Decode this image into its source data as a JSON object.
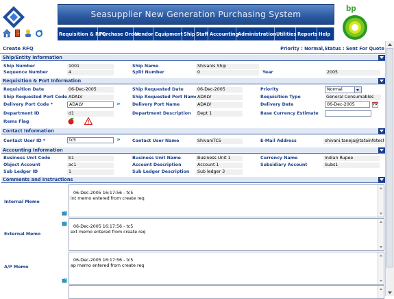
{
  "app": {
    "banner_title": "Seasupplier New Generation Purchasing System",
    "bp_logo_text": "bp"
  },
  "menu": [
    {
      "label": "Requisition & RFQ"
    },
    {
      "label": "Purchase Order"
    },
    {
      "label": "Vendor"
    },
    {
      "label": "Equipment"
    },
    {
      "label": "Ship"
    },
    {
      "label": "Staff"
    },
    {
      "label": "Accounting"
    },
    {
      "label": "Administration"
    },
    {
      "label": "Utilities"
    },
    {
      "label": "Reports"
    },
    {
      "label": "Help"
    }
  ],
  "page": {
    "title": "Create RFQ",
    "status": "Priority : Normal,Status : Sent For Quote"
  },
  "sections": {
    "ship": "Ship/Entity Information",
    "req": "Requisition & Port Information",
    "contact": "Contact Information",
    "accounting": "Accounting Information",
    "comments": "Comments and Instructions"
  },
  "ship": {
    "ship_number_label": "Ship Number",
    "ship_number": "1001",
    "ship_name_label": "Ship Name",
    "ship_name": "Shivanis Ship",
    "sequence_label": "Sequence Number",
    "sequence": "4",
    "split_label": "Split Number",
    "split": "0",
    "year_label": "Year",
    "year": "2005"
  },
  "req": {
    "req_date_label": "Requisition Date",
    "req_date": "06-Dec-2005",
    "ship_req_date_label": "Ship Requested Date",
    "ship_req_date": "06-Dec-2005",
    "priority_label": "Priority",
    "priority": "Normal",
    "ship_port_code_label": "Ship Requested Port Code",
    "ship_port_code": "ADALV",
    "ship_port_name_label": "Ship Requested Port Name",
    "ship_port_name": "ADALV",
    "req_type_label": "Requisition Type",
    "req_type": "General Consumables",
    "delivery_port_code_label": "Delivery Port Code *",
    "delivery_port_code": "ADALV",
    "delivery_port_name_label": "Delivery Port Name",
    "delivery_port_name": "ADALV",
    "delivery_date_label": "Delivery Date",
    "delivery_date": "06-Dec-2005",
    "dept_id_label": "Department ID",
    "dept_id": "d1",
    "dept_desc_label": "Department Description",
    "dept_desc": "Dept 1",
    "base_currency_label": "Base Currency Estimate",
    "base_currency": "",
    "items_flag_label": "Items Flag"
  },
  "contact": {
    "user_id_label": "Contact User ID *",
    "user_id": "tc5",
    "user_name_label": "Contact User Name",
    "user_name": "ShivaniTC5",
    "email_label": "E-Mail Address",
    "email": "shivani.taneja@tatainfotech"
  },
  "accounting": {
    "bu_code_label": "Business Unit Code",
    "bu_code": "b1",
    "bu_name_label": "Business Unit Name",
    "bu_name": "Business Unit 1",
    "currency_label": "Currency Name",
    "currency": "Indian Rupee",
    "object_label": "Object Account",
    "object": "ac1",
    "acct_desc_label": "Account Description",
    "acct_desc": "Account 1",
    "subsidiary_label": "Subsidiary Account",
    "subsidiary": "Subs1",
    "sub_ledger_label": "Sub Ledger ID",
    "sub_ledger": "1",
    "sub_ledger_desc_label": "Sub Ledger Description",
    "sub_ledger_desc": "Sub ledger 3"
  },
  "comments": {
    "internal_label": "Internal Memo",
    "internal": "06-Dec-2005 16:17:56 - tc5\nint memo entered from create req",
    "external_label": "External Memo",
    "external": "06-Dec-2005 16:17:56 - tc5\next memo entered from create req",
    "ap_label": "A/P Memo",
    "ap": "06-Dec-2005 16:17:56 - tc5\nap memo entered from create req"
  },
  "colors": {
    "menu_bg": "#0b3b8c",
    "section_text": "#1b3f8c",
    "banner": "#2c5aa0"
  }
}
